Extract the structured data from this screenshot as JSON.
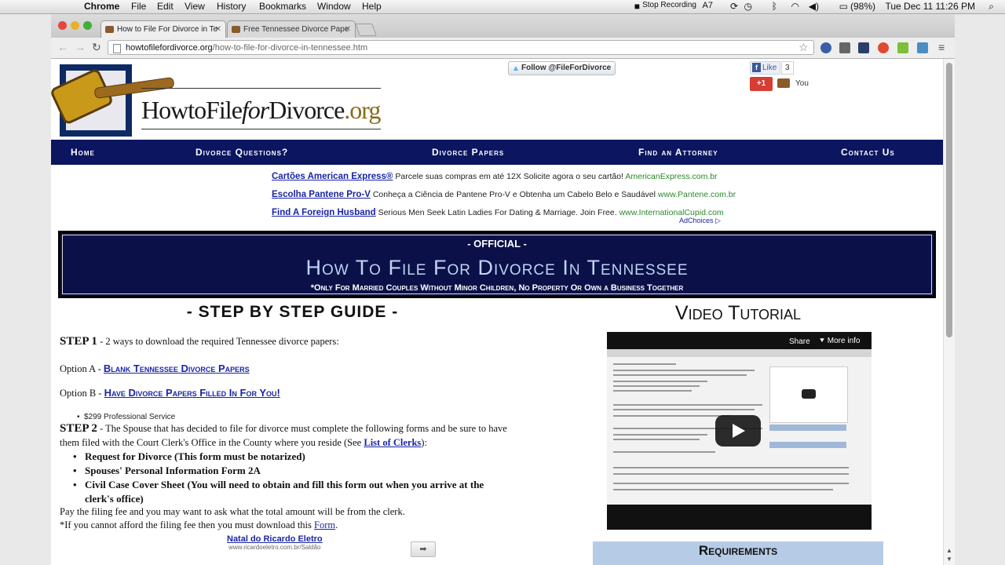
{
  "menubar": {
    "app": "Chrome",
    "menus": [
      "File",
      "Edit",
      "View",
      "History",
      "Bookmarks",
      "Window",
      "Help"
    ],
    "stop_recording": "Stop Recording",
    "adobe": "7",
    "battery": "(98%)",
    "clock": "Tue Dec 11  11:26 PM"
  },
  "tabs": [
    {
      "title": "How to File For Divorce in Te"
    },
    {
      "title": "Free Tennessee Divorce Pape"
    }
  ],
  "url": {
    "host": "howtofilefordivorce.org",
    "path": "/how-to-file-for-divorce-in-tennessee.htm"
  },
  "social": {
    "twitter": "Follow @FileForDivorce",
    "like": "Like",
    "like_count": "3",
    "gplus": "+1",
    "you": "You"
  },
  "logo": {
    "pre": "HowtoFile",
    "em": "for",
    "post": "Divorce",
    "org": ".org"
  },
  "nav": [
    "Home",
    "Divorce Questions?",
    "Divorce Papers",
    "Find an Attorney",
    "Contact Us"
  ],
  "ads": [
    {
      "title": "Cartões American Express®",
      "text": "Parcele suas compras em até 12X Solicite agora o seu cartão!",
      "domain": "AmericanExpress.com.br"
    },
    {
      "title": "Escolha Pantene Pro-V",
      "text": "Conheça a Ciência de Pantene Pro-V e Obtenha um Cabelo Belo e Saudável",
      "domain": "www.Pantene.com.br"
    },
    {
      "title": "Find A Foreign Husband",
      "text": "Serious Men Seek Latin Ladies For Dating & Marriage. Join Free.",
      "domain": "www.InternationalCupid.com"
    }
  ],
  "adchoices": "AdChoices ▷",
  "banner": {
    "official": "- OFFICIAL -",
    "title": "How To File For Divorce In Tennessee",
    "subtitle": "*Only For Married Couples Without Minor Children, No Property Or Own a Business Together"
  },
  "guide": {
    "heading": "- STEP BY STEP GUIDE -",
    "step1_label": "STEP 1",
    "step1_text": " - 2 ways to download the required Tennessee divorce papers:",
    "optionA_label": "Option A - ",
    "optionA_link": "Blank Tennessee Divorce Papers",
    "optionB_label": "Option B - ",
    "optionB_link": "Have Divorce Papers Filled In For You!",
    "optionB_note": "$299 Professional Service",
    "step2_label": "STEP 2",
    "step2_text_1": " - The Spouse that has decided to file for divorce must complete the following forms and be sure to have",
    "step2_text_2": "them filed with the Court Clerk's Office in the County where you reside (See ",
    "clerks_link": "List of Clerks",
    "step2_text_3": "):",
    "forms": [
      "Request for Divorce (This form must be notarized)",
      "Spouses' Personal Information Form 2A",
      "Civil Case Cover Sheet (You will need to obtain and fill this form out when you arrive at the",
      "clerk's office)"
    ],
    "fee_line": "Pay the filing fee and you may want to ask what the total amount will be from the clerk.",
    "afford_line": "*If you cannot afford the filing fee then you must download this ",
    "form_link": "Form",
    "afford_end": "."
  },
  "bottom_ad": {
    "title": "Natal do Ricardo Eletro",
    "domain": "www.ricardoeletro.com.br/Saldão"
  },
  "video": {
    "heading": "Video Tutorial",
    "share": "Share",
    "more_info": "More info"
  },
  "requirements": "Requirements",
  "colors": {
    "navy": "#0b1560",
    "link": "#1a25a6",
    "banner_title": "#bfd3f2"
  }
}
